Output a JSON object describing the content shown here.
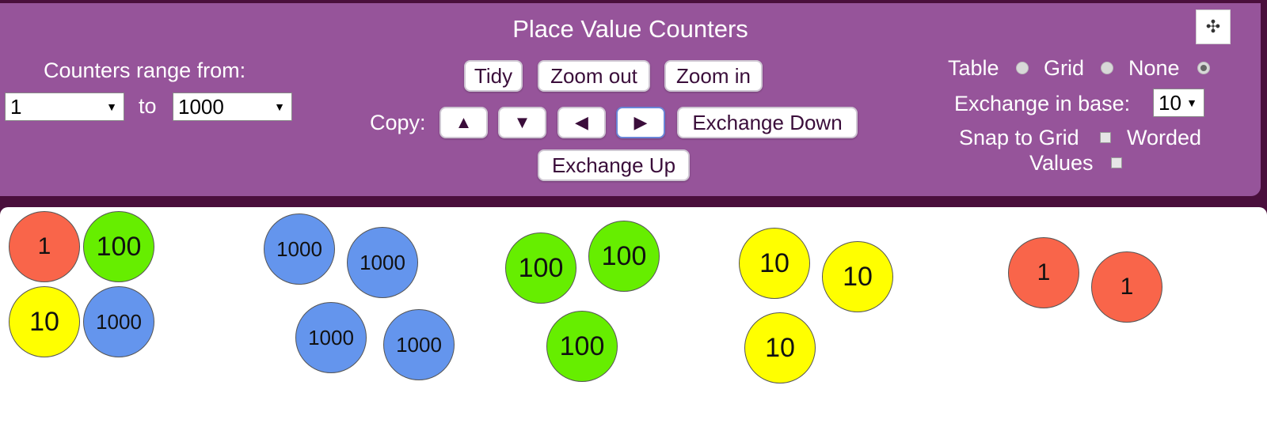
{
  "toolbar": {
    "title": "Place Value Counters",
    "range_label": "Counters range from:",
    "range_from": "1",
    "range_to_label": "to",
    "range_to": "1000",
    "tidy_label": "Tidy",
    "zoom_out_label": "Zoom out",
    "zoom_in_label": "Zoom in",
    "copy_label": "Copy:",
    "copy_up_glyph": "▲",
    "copy_down_glyph": "▼",
    "copy_left_glyph": "◀",
    "copy_right_glyph": "▶",
    "exchange_down_label": "Exchange Down",
    "exchange_up_label": "Exchange Up",
    "layout_options": [
      {
        "label": "Table",
        "selected": false
      },
      {
        "label": "Grid",
        "selected": false
      },
      {
        "label": "None",
        "selected": true
      }
    ],
    "exchange_base_label": "Exchange in base:",
    "exchange_base_value": "10",
    "snap_to_grid_label": "Snap to Grid",
    "snap_to_grid_checked": false,
    "worded_label": "Worded",
    "values_label": "Values",
    "worded_values_checked": false
  },
  "colors": {
    "toolbar_bg": "#96549a",
    "counter_1": "#f9654a",
    "counter_10": "#ffff00",
    "counter_100": "#66ee00",
    "counter_1000": "#6495ed"
  },
  "counters": [
    {
      "value": "1"
    },
    {
      "value": "100"
    },
    {
      "value": "10"
    },
    {
      "value": "1000"
    },
    {
      "value": "1000"
    },
    {
      "value": "1000"
    },
    {
      "value": "1000"
    },
    {
      "value": "1000"
    },
    {
      "value": "100"
    },
    {
      "value": "100"
    },
    {
      "value": "100"
    },
    {
      "value": "10"
    },
    {
      "value": "10"
    },
    {
      "value": "10"
    },
    {
      "value": "1"
    },
    {
      "value": "1"
    }
  ]
}
